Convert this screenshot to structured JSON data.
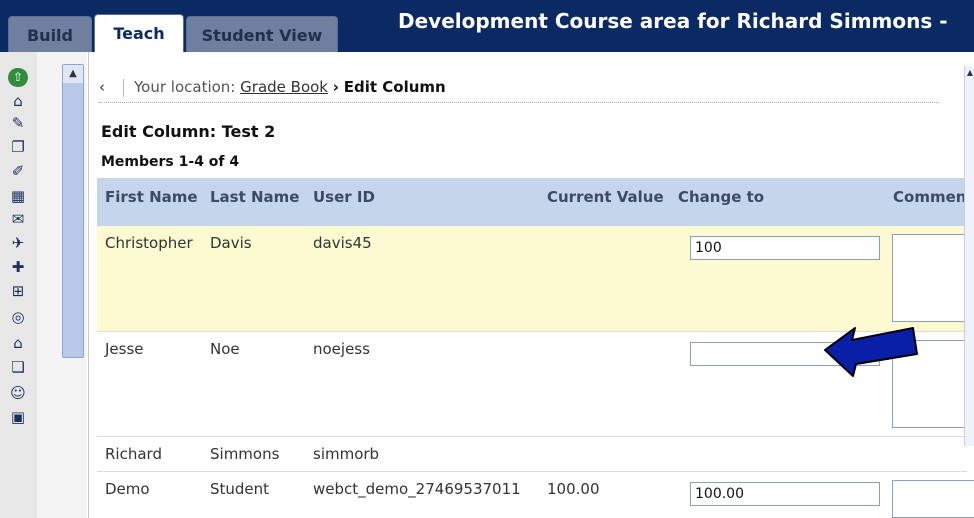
{
  "tabs": [
    {
      "label": "Build"
    },
    {
      "label": "Teach"
    },
    {
      "label": "Student View"
    }
  ],
  "course_title": "Development Course area for Richard Simmons -",
  "breadcrumb": {
    "prefix": "Your location:",
    "link": "Grade Book",
    "separator": "›",
    "current": "Edit Column"
  },
  "page_title": "Edit Column: Test 2",
  "members_label": "Members 1-4 of 4",
  "table": {
    "headers": [
      "First Name",
      "Last Name",
      "User ID",
      "Current Value",
      "Change to",
      "Commen"
    ],
    "rows": [
      {
        "first": "Christopher",
        "last": "Davis",
        "user_id": "davis45",
        "current": "",
        "change_to": "100"
      },
      {
        "first": "Jesse",
        "last": "Noe",
        "user_id": "noejess",
        "current": "",
        "change_to": ""
      },
      {
        "first": "Richard",
        "last": "Simmons",
        "user_id": "simmorb",
        "current": "",
        "change_to": ""
      },
      {
        "first": "Demo",
        "last": "Student",
        "user_id": "webct_demo_27469537011",
        "current": "100.00",
        "change_to": "100.00"
      }
    ]
  },
  "colors": {
    "topbar": "#0b2a63",
    "header_row": "#c5d5ec",
    "highlight_row": "#fdfad1",
    "arrow": "#0a1fa8"
  },
  "icons": [
    "collapse-icon",
    "home-icon",
    "tools-icon",
    "content-icon",
    "edit-tool-icon",
    "gradebook-icon",
    "discussion-icon",
    "pin-icon",
    "reports-icon",
    "add-file-icon",
    "cd-icon",
    "mail-icon",
    "files-icon",
    "users-icon",
    "scorm-icon"
  ]
}
